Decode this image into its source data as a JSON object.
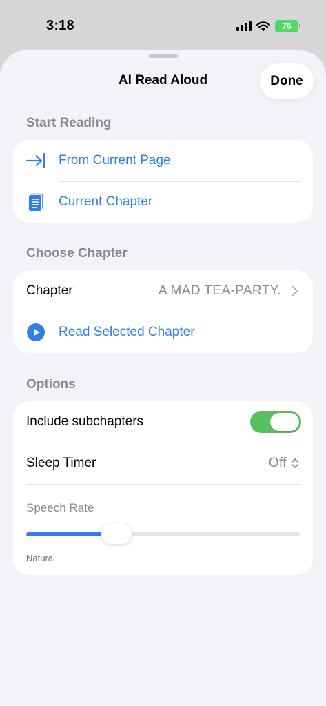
{
  "status": {
    "time": "3:18",
    "battery": "76"
  },
  "sheet": {
    "title": "AI Read Aloud",
    "done_label": "Done"
  },
  "start_reading": {
    "header": "Start Reading",
    "items": [
      {
        "label": "From Current Page",
        "icon": "arrow-to-line-icon"
      },
      {
        "label": "Current Chapter",
        "icon": "document-icon"
      }
    ]
  },
  "choose_chapter": {
    "header": "Choose Chapter",
    "chapter_label": "Chapter",
    "chapter_value": "A MAD TEA-PARTY.",
    "read_selected_label": "Read Selected Chapter"
  },
  "options": {
    "header": "Options",
    "subchapters_label": "Include subchapters",
    "subchapters_enabled": true,
    "sleep_timer_label": "Sleep Timer",
    "sleep_timer_value": "Off",
    "speech_rate_label": "Speech Rate",
    "speech_rate_value": 0.33,
    "speech_rate_caption": "Natural"
  },
  "colors": {
    "accent": "#2f7fe6",
    "toggle_on": "#5ac05e",
    "battery": "#4cd964"
  }
}
